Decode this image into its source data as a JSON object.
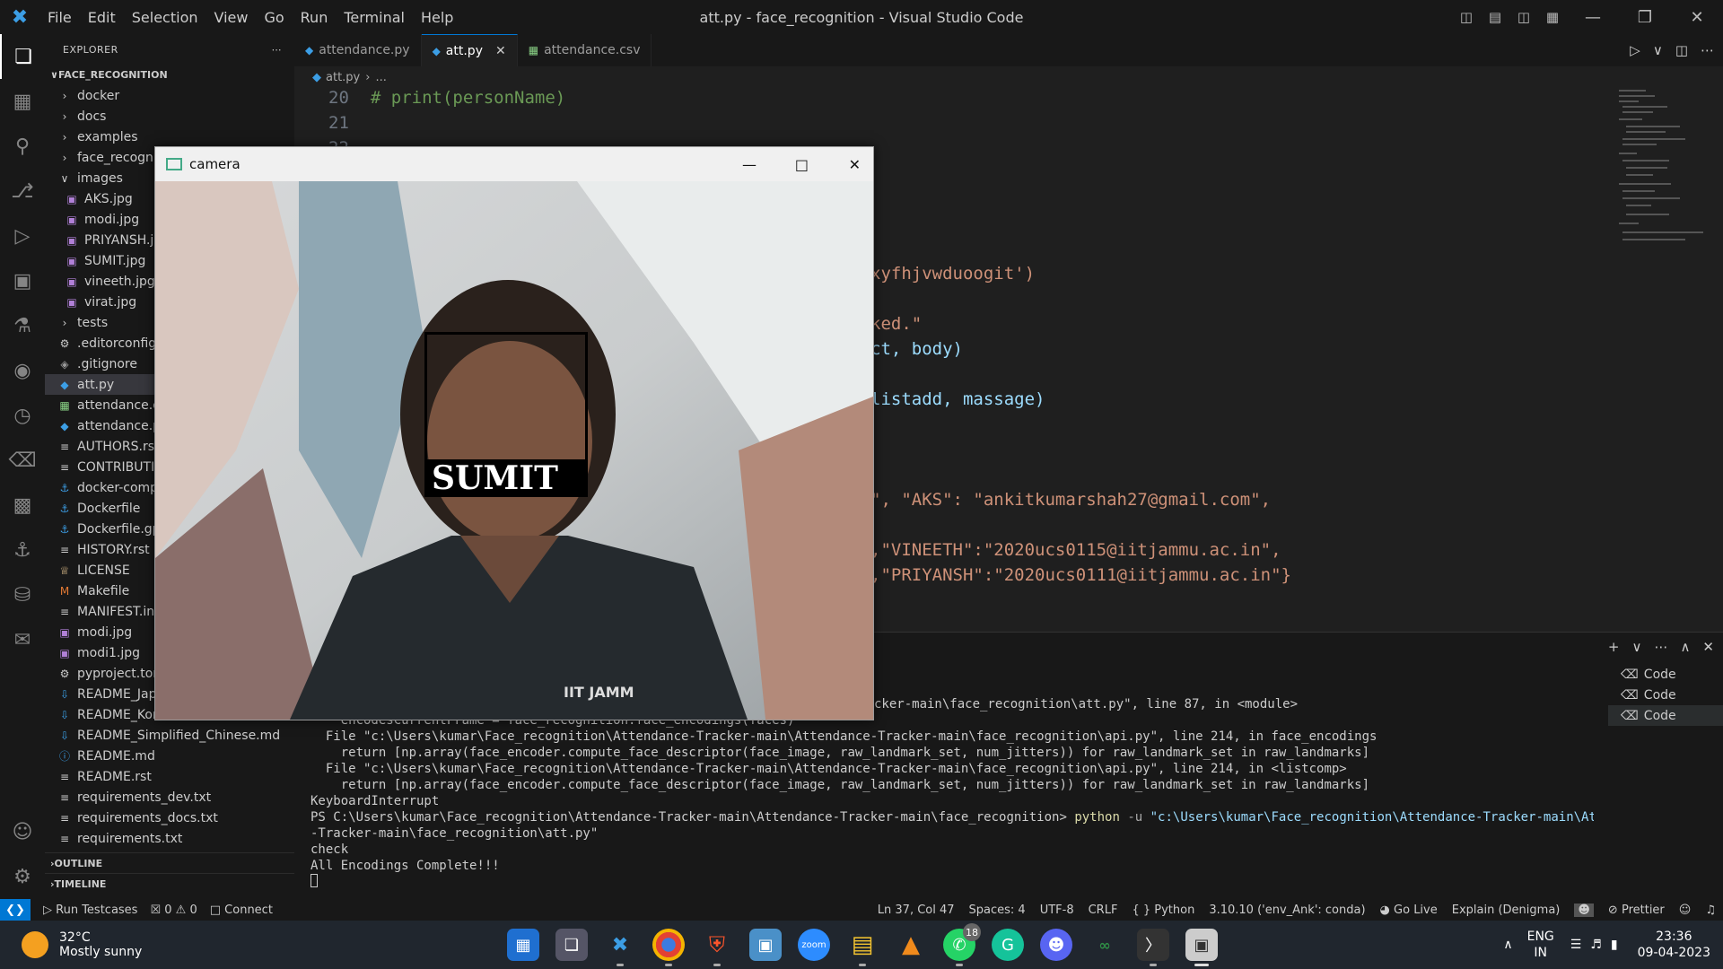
{
  "window": {
    "title": "att.py - face_recognition - Visual Studio Code",
    "menu": [
      "File",
      "Edit",
      "Selection",
      "View",
      "Go",
      "Run",
      "Terminal",
      "Help"
    ]
  },
  "sidebar": {
    "header": "EXPLORER",
    "root": "FACE_RECOGNITION",
    "items": [
      {
        "label": "docker",
        "type": "folder",
        "indent": 0,
        "open": false
      },
      {
        "label": "docs",
        "type": "folder",
        "indent": 0,
        "open": false
      },
      {
        "label": "examples",
        "type": "folder",
        "indent": 0,
        "open": false
      },
      {
        "label": "face_recogniti",
        "type": "folder",
        "indent": 0,
        "open": false
      },
      {
        "label": "images",
        "type": "folder",
        "indent": 0,
        "open": true
      },
      {
        "label": "AKS.jpg",
        "type": "image",
        "indent": 1
      },
      {
        "label": "modi.jpg",
        "type": "image",
        "indent": 1
      },
      {
        "label": "PRIYANSH.jpg",
        "type": "image",
        "indent": 1
      },
      {
        "label": "SUMIT.jpg",
        "type": "image",
        "indent": 1
      },
      {
        "label": "vineeth.jpg",
        "type": "image",
        "indent": 1
      },
      {
        "label": "virat.jpg",
        "type": "image",
        "indent": 1
      },
      {
        "label": "tests",
        "type": "folder",
        "indent": 0,
        "open": false
      },
      {
        "label": ".editorconfig",
        "type": "gear",
        "indent": 0
      },
      {
        "label": ".gitignore",
        "type": "git",
        "indent": 0
      },
      {
        "label": "att.py",
        "type": "python",
        "indent": 0,
        "selected": true
      },
      {
        "label": "attendance.csv",
        "type": "csv",
        "indent": 0
      },
      {
        "label": "attendance.py",
        "type": "python",
        "indent": 0
      },
      {
        "label": "AUTHORS.rst",
        "type": "text",
        "indent": 0
      },
      {
        "label": "CONTRIBUTIN",
        "type": "text",
        "indent": 0
      },
      {
        "label": "docker-compo",
        "type": "docker",
        "indent": 0
      },
      {
        "label": "Dockerfile",
        "type": "docker",
        "indent": 0
      },
      {
        "label": "Dockerfile.gpu",
        "type": "docker",
        "indent": 0
      },
      {
        "label": "HISTORY.rst",
        "type": "text",
        "indent": 0
      },
      {
        "label": "LICENSE",
        "type": "license",
        "indent": 0
      },
      {
        "label": "Makefile",
        "type": "make",
        "indent": 0
      },
      {
        "label": "MANIFEST.in",
        "type": "text",
        "indent": 0
      },
      {
        "label": "modi.jpg",
        "type": "image",
        "indent": 0
      },
      {
        "label": "modi1.jpg",
        "type": "image",
        "indent": 0
      },
      {
        "label": "pyproject.toml",
        "type": "gear",
        "indent": 0
      },
      {
        "label": "README_Japa",
        "type": "md",
        "indent": 0
      },
      {
        "label": "README_Kore",
        "type": "md",
        "indent": 0
      },
      {
        "label": "README_Simplified_Chinese.md",
        "type": "md",
        "indent": 0
      },
      {
        "label": "README.md",
        "type": "info",
        "indent": 0
      },
      {
        "label": "README.rst",
        "type": "text",
        "indent": 0
      },
      {
        "label": "requirements_dev.txt",
        "type": "text",
        "indent": 0
      },
      {
        "label": "requirements_docs.txt",
        "type": "text",
        "indent": 0
      },
      {
        "label": "requirements.txt",
        "type": "text",
        "indent": 0
      }
    ],
    "outline": "OUTLINE",
    "timeline": "TIMELINE"
  },
  "tabs": [
    {
      "label": "attendance.py",
      "icon": "python",
      "active": false
    },
    {
      "label": "att.py",
      "icon": "python",
      "active": true
    },
    {
      "label": "attendance.csv",
      "icon": "csv",
      "active": false
    }
  ],
  "breadcrumb": {
    "file": "att.py",
    "rest": "..."
  },
  "editor": {
    "lines": [
      {
        "n": "20",
        "text": "# print(personName)"
      },
      {
        "n": "21",
        "text": ""
      },
      {
        "n": "22",
        "text": ""
      }
    ],
    "fragments": [
      {
        "text": "xyfhjvwduoogit')"
      },
      {
        "text": "ked.\""
      },
      {
        "text": "ct, body)"
      },
      {
        "text": "listadd, massage)"
      },
      {
        "text": "\", \"AKS\": \"ankitkumarshah27@gmail.com\","
      },
      {
        "text": ",\"VINEETH\":\"2020ucs0115@iitjammu.ac.in\","
      },
      {
        "text": ",\"PRIYANSH\":\"2020ucs0111@iitjammu.ac.in\"}"
      }
    ]
  },
  "terminal": {
    "lines": [
      "cker-main\\face_recognition\\att.py\", line 87, in <module>",
      "    encodesCurrentFrame = face_recognition.face_encodings(faces)",
      "  File \"c:\\Users\\kumar\\Face_recognition\\Attendance-Tracker-main\\Attendance-Tracker-main\\face_recognition\\api.py\", line 214, in face_encodings",
      "    return [np.array(face_encoder.compute_face_descriptor(face_image, raw_landmark_set, num_jitters)) for raw_landmark_set in raw_landmarks]",
      "  File \"c:\\Users\\kumar\\Face_recognition\\Attendance-Tracker-main\\Attendance-Tracker-main\\face_recognition\\api.py\", line 214, in <listcomp>",
      "    return [np.array(face_encoder.compute_face_descriptor(face_image, raw_landmark_set, num_jitters)) for raw_landmark_set in raw_landmarks]",
      "KeyboardInterrupt"
    ],
    "prompt": "PS C:\\Users\\kumar\\Face_recognition\\Attendance-Tracker-main\\Attendance-Tracker-main\\face_recognition>",
    "cmd": "python",
    "flag": "-u",
    "path1": "\"c:\\Users\\kumar\\Face_recognition\\Attendance-Tracker-main\\Attendance",
    "path2": "-Tracker-main\\face_recognition\\att.py\"",
    "out1": "check",
    "out2": "All Encodings Complete!!!",
    "list": [
      "Code",
      "Code",
      "Code"
    ]
  },
  "camera": {
    "title": "camera",
    "label": "SUMIT",
    "shirt_text": "IIT JAMM"
  },
  "statusbar": {
    "run": "Run Testcases",
    "errors": "0",
    "warnings": "0",
    "connect": "Connect",
    "position": "Ln 37, Col 47",
    "spaces": "Spaces: 4",
    "encoding": "UTF-8",
    "eol": "CRLF",
    "language": "Python",
    "interpreter": "3.10.10 ('env_Ank': conda)",
    "golive": "Go Live",
    "explain": "Explain (Denigma)",
    "prettier": "Prettier"
  },
  "taskbar": {
    "temp": "32°C",
    "weather": "Mostly sunny",
    "lang1": "ENG",
    "lang2": "IN",
    "time": "23:36",
    "date": "09-04-2023",
    "whatsapp_badge": "18"
  },
  "colors": {
    "accent": "#0078d4",
    "selection": "#0b3a6b"
  }
}
